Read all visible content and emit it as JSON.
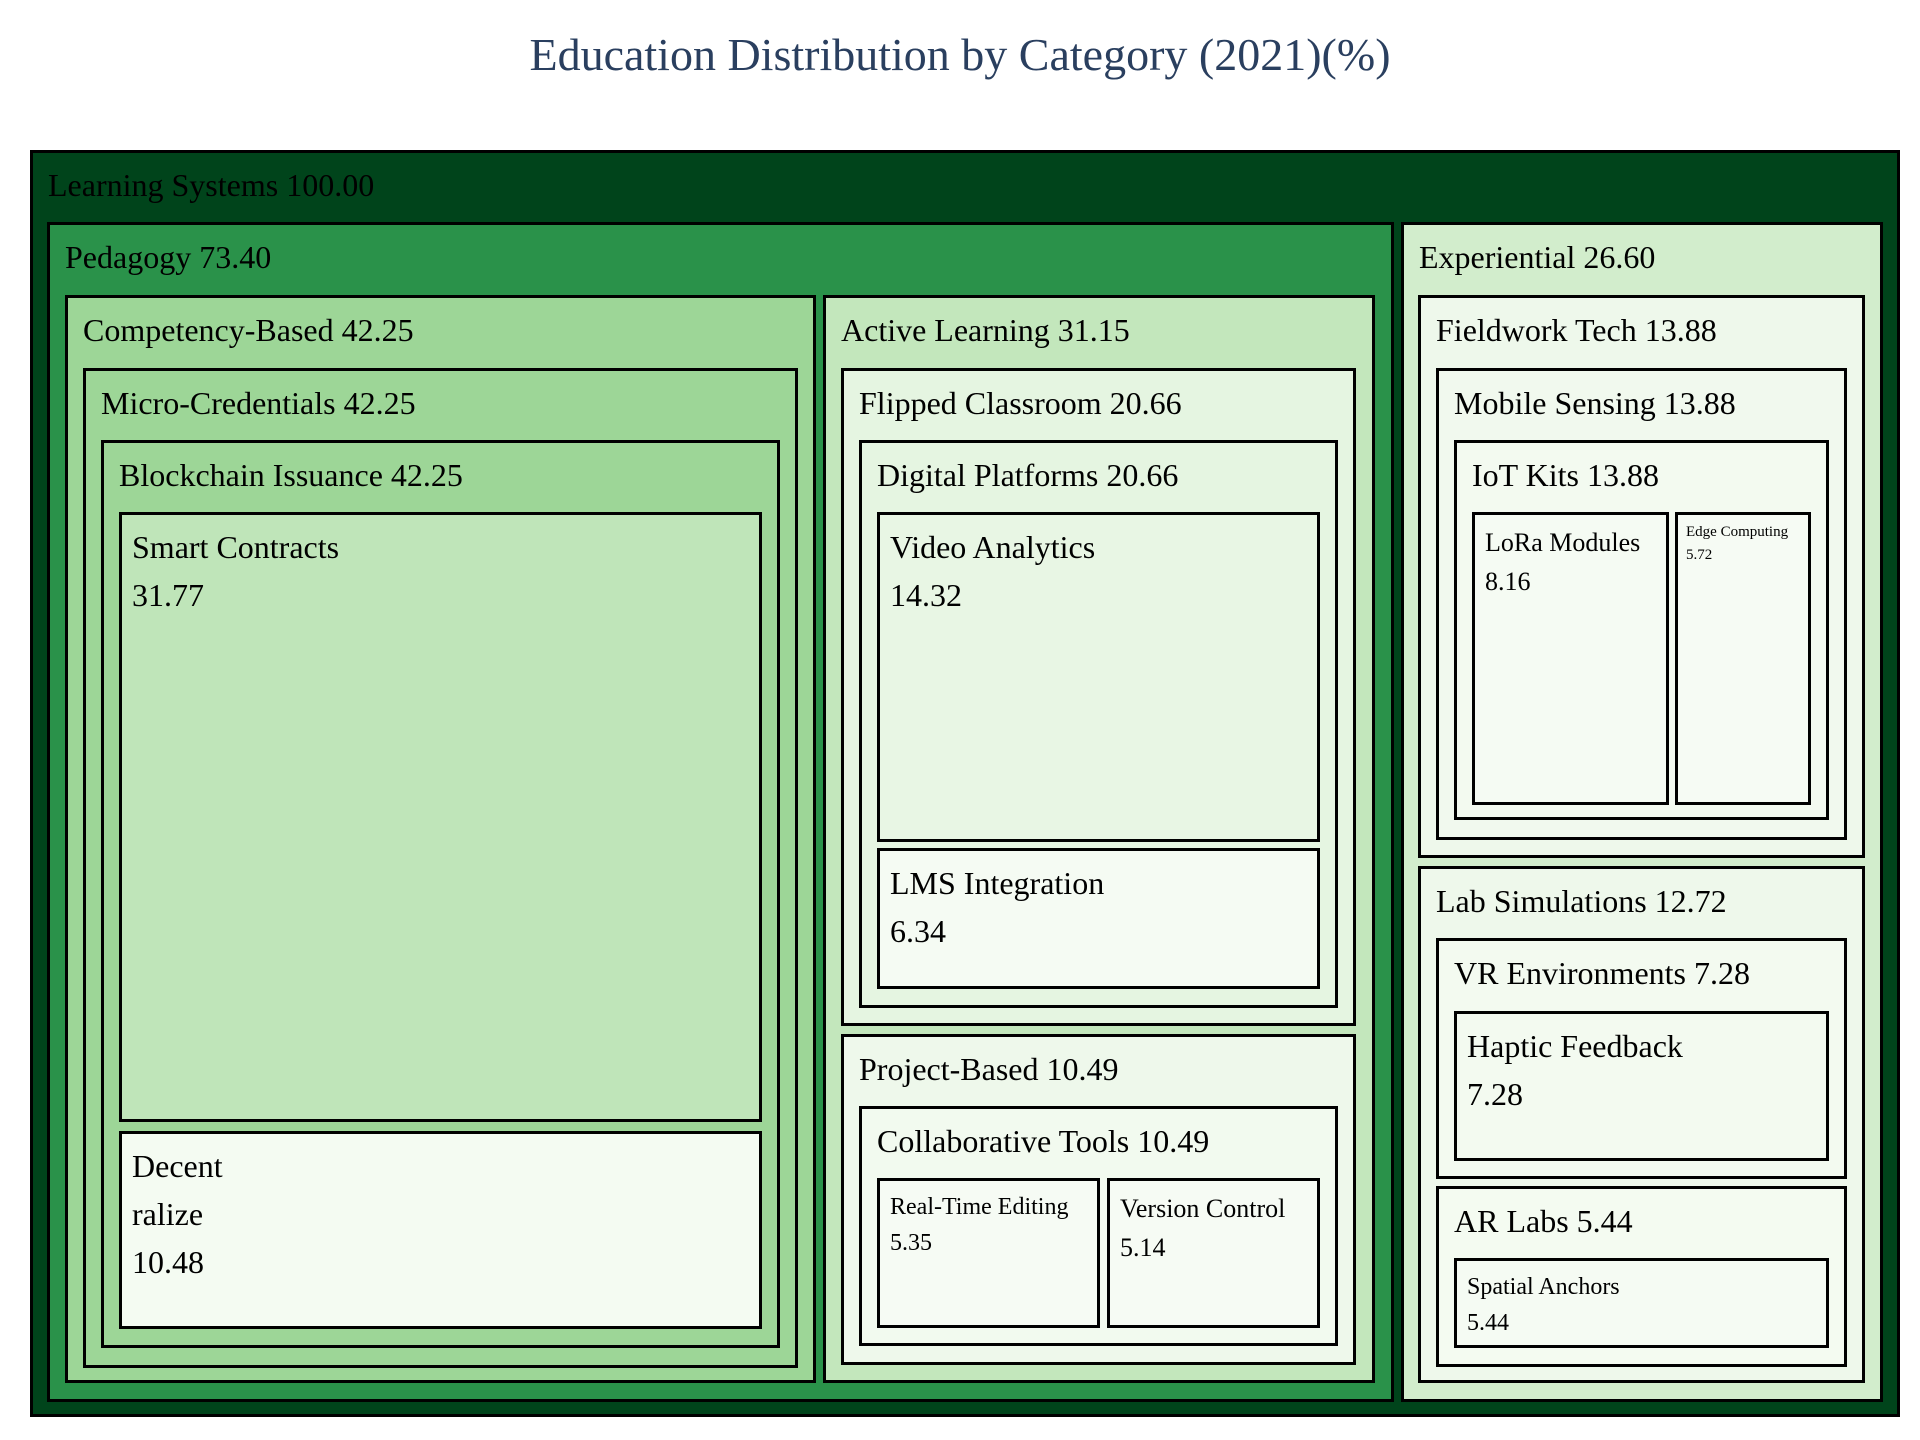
{
  "chart_data": {
    "type": "treemap",
    "title": "Education Distribution by Category (2021)(%)",
    "nodes": [
      {
        "id": "learning-systems",
        "label": "Learning Systems",
        "value": "100.00",
        "parent": "",
        "color": "#00441b"
      },
      {
        "id": "pedagogy",
        "label": "Pedagogy",
        "value": "73.40",
        "parent": "learning-systems",
        "color": "#2a924a"
      },
      {
        "id": "competency-based",
        "label": "Competency-Based",
        "value": "42.25",
        "parent": "pedagogy",
        "color": "#9dd697"
      },
      {
        "id": "micro-credentials",
        "label": "Micro-Credentials",
        "value": "42.25",
        "parent": "competency-based",
        "color": "#9dd697"
      },
      {
        "id": "blockchain-issuance",
        "label": "Blockchain Issuance",
        "value": "42.25",
        "parent": "micro-credentials",
        "color": "#9dd697"
      },
      {
        "id": "smart-contracts",
        "label": "Smart Contracts",
        "value": "31.77",
        "parent": "blockchain-issuance",
        "color": "#bfe5b9"
      },
      {
        "id": "decentralize",
        "label": "Decent\nralize",
        "value": "10.48",
        "parent": "blockchain-issuance",
        "color": "#f4fbf2"
      },
      {
        "id": "active-learning",
        "label": "Active Learning",
        "value": "31.15",
        "parent": "pedagogy",
        "color": "#c3e7bc"
      },
      {
        "id": "flipped-classroom",
        "label": "Flipped Classroom",
        "value": "20.66",
        "parent": "active-learning",
        "color": "#e5f5e1"
      },
      {
        "id": "digital-platforms",
        "label": "Digital Platforms",
        "value": "20.66",
        "parent": "flipped-classroom",
        "color": "#e5f5e1"
      },
      {
        "id": "video-analytics",
        "label": "Video Analytics",
        "value": "14.32",
        "parent": "digital-platforms",
        "color": "#e8f6e4"
      },
      {
        "id": "lms-integration",
        "label": "LMS Integration",
        "value": "6.34",
        "parent": "digital-platforms",
        "color": "#f5fbf3"
      },
      {
        "id": "project-based",
        "label": "Project-Based",
        "value": "10.49",
        "parent": "active-learning",
        "color": "#eef8eb"
      },
      {
        "id": "collaborative-tools",
        "label": "Collaborative Tools",
        "value": "10.49",
        "parent": "project-based",
        "color": "#f2faef"
      },
      {
        "id": "real-time-editing",
        "label": "Real-Time Editing",
        "value": "5.35",
        "parent": "collaborative-tools",
        "color": "#f6fbf4"
      },
      {
        "id": "version-control",
        "label": "Version Control",
        "value": "5.14",
        "parent": "collaborative-tools",
        "color": "#f6fbf4"
      },
      {
        "id": "experiential",
        "label": "Experiential",
        "value": "26.60",
        "parent": "learning-systems",
        "color": "#d2edcc"
      },
      {
        "id": "fieldwork-tech",
        "label": "Fieldwork Tech",
        "value": "13.88",
        "parent": "experiential",
        "color": "#eef8eb"
      },
      {
        "id": "mobile-sensing",
        "label": "Mobile Sensing",
        "value": "13.88",
        "parent": "fieldwork-tech",
        "color": "#f1f9ee"
      },
      {
        "id": "iot-kits",
        "label": "IoT Kits",
        "value": "13.88",
        "parent": "mobile-sensing",
        "color": "#f3faf0"
      },
      {
        "id": "lora-modules",
        "label": "LoRa Modules",
        "value": "8.16",
        "parent": "iot-kits",
        "color": "#f5fbf3"
      },
      {
        "id": "edge-computing",
        "label": "Edge Computing",
        "value": "5.72",
        "parent": "iot-kits",
        "color": "#f6fbf4"
      },
      {
        "id": "lab-simulations",
        "label": "Lab Simulations",
        "value": "12.72",
        "parent": "experiential",
        "color": "#eef8eb"
      },
      {
        "id": "vr-environments",
        "label": "VR Environments",
        "value": "7.28",
        "parent": "lab-simulations",
        "color": "#f3faf0"
      },
      {
        "id": "haptic-feedback",
        "label": "Haptic Feedback",
        "value": "7.28",
        "parent": "vr-environments",
        "color": "#f3faf0"
      },
      {
        "id": "ar-labs",
        "label": "AR Labs",
        "value": "5.44",
        "parent": "lab-simulations",
        "color": "#f4fbf1"
      },
      {
        "id": "spatial-anchors",
        "label": "Spatial Anchors",
        "value": "5.44",
        "parent": "ar-labs",
        "color": "#f5fbf3"
      }
    ]
  }
}
